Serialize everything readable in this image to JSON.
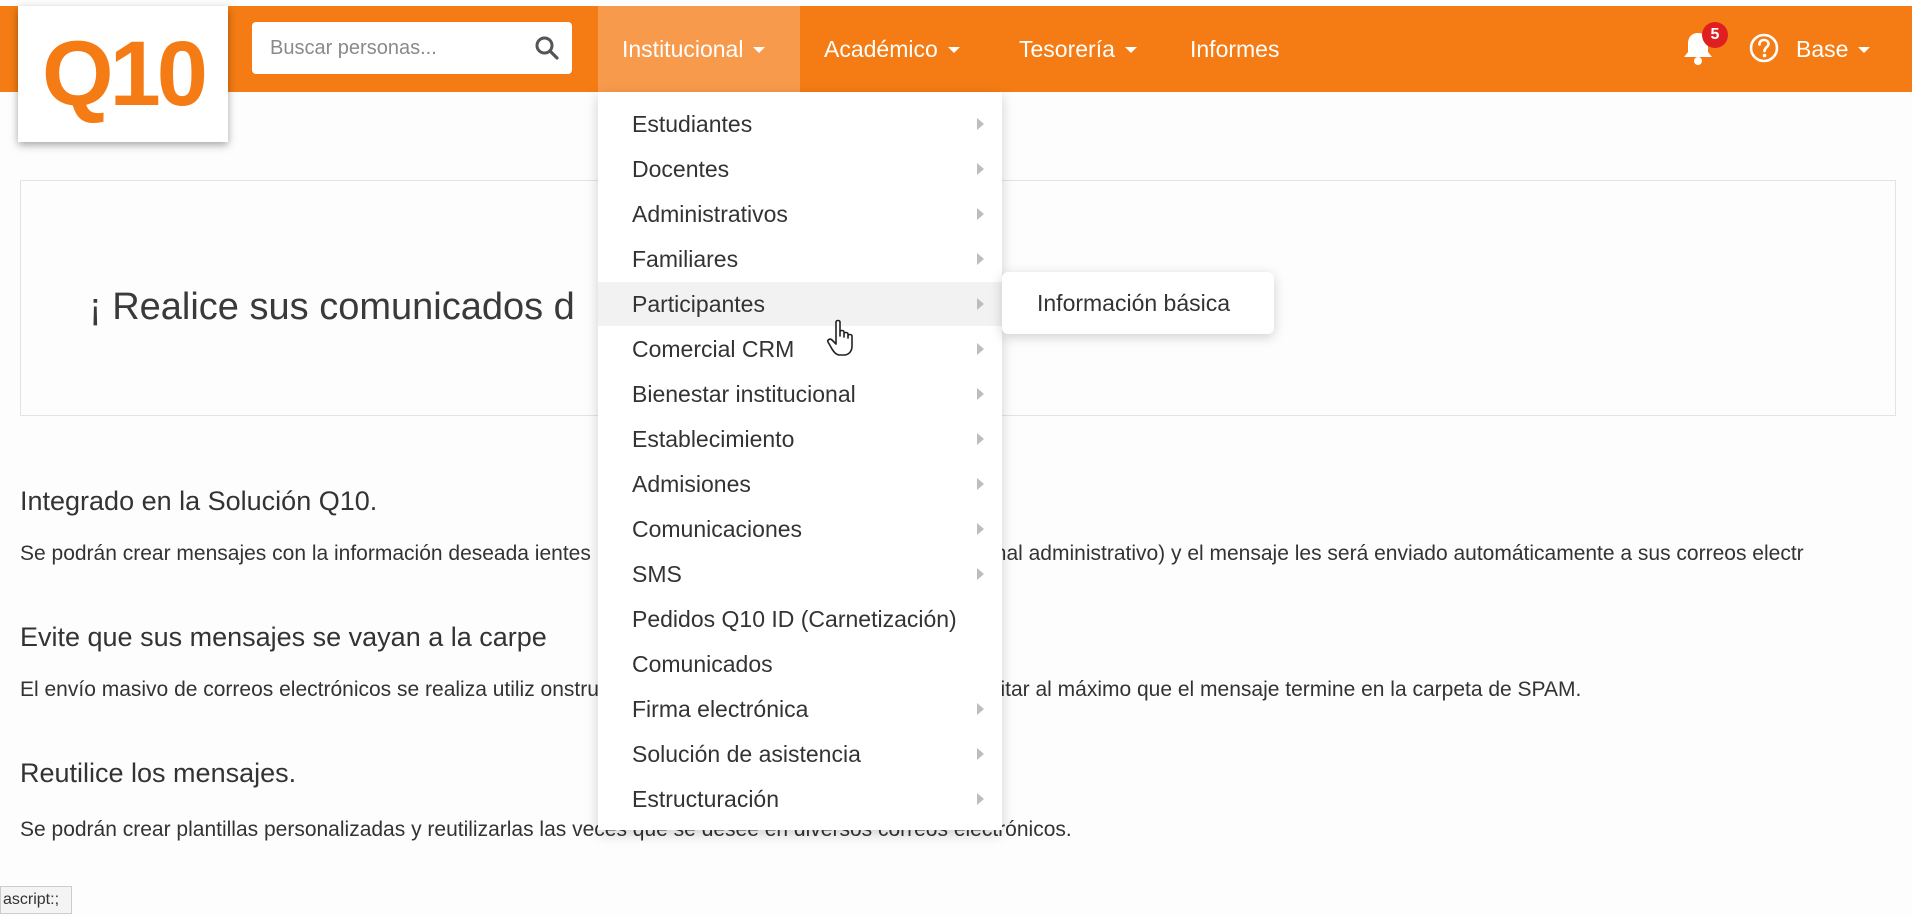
{
  "logo": {
    "text": "Q10",
    "color": "#f57c14"
  },
  "search": {
    "placeholder": "Buscar personas...",
    "icon": "search-icon"
  },
  "nav": {
    "institucional": "Institucional",
    "academico": "Académico",
    "tesoreria": "Tesorería",
    "informes": "Informes",
    "base": "Base"
  },
  "notifications": {
    "count": "5",
    "icon": "bell-icon"
  },
  "help": {
    "icon": "help-icon"
  },
  "colors": {
    "brand": "#f57c14",
    "active_tab": "#f79a4c",
    "badge": "#e02020"
  },
  "banner": {
    "text": "¡ Realice sus comunicados d"
  },
  "sections": [
    {
      "title": "Integrado en la Solución Q10.",
      "body": "Se podrán crear mensajes con la información deseada                                                           ientes potenciales, estudiantes, docentes o personal administrativo) y el mensaje les será enviado automáticamente a sus correos electr"
    },
    {
      "title": "Evite que sus mensajes se vayan a la carpe",
      "body": "El envío masivo de correos electrónicos se realiza utiliz                                                          onstruido utilizando las mejores prácticas para evitar al máximo que el mensaje termine en la carpeta de SPAM."
    },
    {
      "title": "Reutilice los mensajes.",
      "body": "Se podrán crear plantillas personalizadas y reutilizarlas las veces que se desee en diversos correos electrónicos."
    }
  ],
  "menu": {
    "items": [
      {
        "label": "Estudiantes",
        "has_submenu": true
      },
      {
        "label": "Docentes",
        "has_submenu": true
      },
      {
        "label": "Administrativos",
        "has_submenu": true
      },
      {
        "label": "Familiares",
        "has_submenu": true
      },
      {
        "label": "Participantes",
        "has_submenu": true,
        "hovered": true
      },
      {
        "label": "Comercial CRM",
        "has_submenu": true
      },
      {
        "label": "Bienestar institucional",
        "has_submenu": true
      },
      {
        "label": "Establecimiento",
        "has_submenu": true
      },
      {
        "label": "Admisiones",
        "has_submenu": true
      },
      {
        "label": "Comunicaciones",
        "has_submenu": true
      },
      {
        "label": "SMS",
        "has_submenu": true
      },
      {
        "label": "Pedidos Q10 ID (Carnetización)",
        "has_submenu": false
      },
      {
        "label": "Comunicados",
        "has_submenu": false
      },
      {
        "label": "Firma electrónica",
        "has_submenu": true
      },
      {
        "label": "Solución de asistencia",
        "has_submenu": true
      },
      {
        "label": "Estructuración",
        "has_submenu": true
      }
    ],
    "submenu": {
      "label": "Información básica"
    }
  },
  "statusbar": {
    "text": "ascript:;"
  }
}
